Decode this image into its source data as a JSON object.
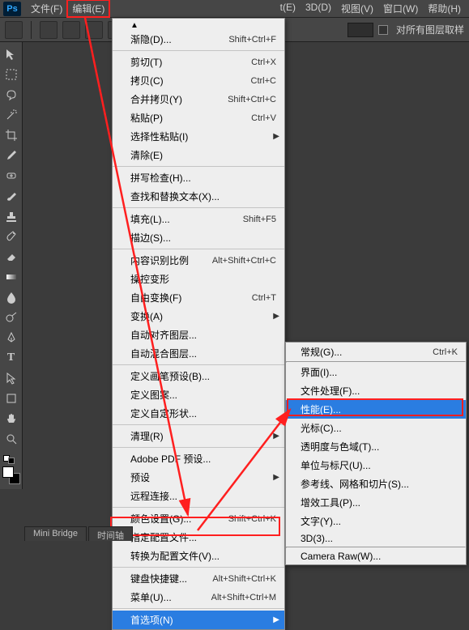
{
  "menubar": {
    "logo": "Ps",
    "items_left": [
      "文件(F)",
      "编辑(E)"
    ],
    "items_right": [
      "t(E)",
      "3D(D)",
      "视图(V)",
      "窗口(W)",
      "帮助(H)"
    ],
    "edit_index": 1
  },
  "toolbar": {
    "sample_all_layers": "对所有图层取样"
  },
  "edit_menu": {
    "items": [
      {
        "label": "渐隐(D)...",
        "shortcut": "Shift+Ctrl+F"
      },
      {
        "sep": true
      },
      {
        "label": "剪切(T)",
        "shortcut": "Ctrl+X"
      },
      {
        "label": "拷贝(C)",
        "shortcut": "Ctrl+C"
      },
      {
        "label": "合并拷贝(Y)",
        "shortcut": "Shift+Ctrl+C"
      },
      {
        "label": "粘贴(P)",
        "shortcut": "Ctrl+V"
      },
      {
        "label": "选择性粘贴(I)",
        "submenu": true
      },
      {
        "label": "清除(E)"
      },
      {
        "sep": true
      },
      {
        "label": "拼写检查(H)..."
      },
      {
        "label": "查找和替换文本(X)..."
      },
      {
        "sep": true
      },
      {
        "label": "填充(L)...",
        "shortcut": "Shift+F5"
      },
      {
        "label": "描边(S)..."
      },
      {
        "sep": true
      },
      {
        "label": "内容识别比例",
        "shortcut": "Alt+Shift+Ctrl+C"
      },
      {
        "label": "操控变形"
      },
      {
        "label": "自由变换(F)",
        "shortcut": "Ctrl+T"
      },
      {
        "label": "变换(A)",
        "submenu": true
      },
      {
        "label": "自动对齐图层..."
      },
      {
        "label": "自动混合图层..."
      },
      {
        "sep": true
      },
      {
        "label": "定义画笔预设(B)..."
      },
      {
        "label": "定义图案..."
      },
      {
        "label": "定义自定形状..."
      },
      {
        "sep": true
      },
      {
        "label": "清理(R)",
        "submenu": true
      },
      {
        "sep": true
      },
      {
        "label": "Adobe PDF 预设..."
      },
      {
        "label": "预设",
        "submenu": true
      },
      {
        "label": "远程连接..."
      },
      {
        "sep": true
      },
      {
        "label": "颜色设置(G)...",
        "shortcut": "Shift+Ctrl+K"
      },
      {
        "label": "指定配置文件..."
      },
      {
        "label": "转换为配置文件(V)..."
      },
      {
        "sep": true
      },
      {
        "label": "键盘快捷键...",
        "shortcut": "Alt+Shift+Ctrl+K"
      },
      {
        "label": "菜单(U)...",
        "shortcut": "Alt+Shift+Ctrl+M"
      },
      {
        "sep": true
      },
      {
        "label": "首选项(N)",
        "submenu": true,
        "highlight": true
      }
    ]
  },
  "prefs_submenu": {
    "items": [
      {
        "label": "常规(G)...",
        "shortcut": "Ctrl+K"
      },
      {
        "sep": true
      },
      {
        "label": "界面(I)..."
      },
      {
        "label": "文件处理(F)..."
      },
      {
        "label": "性能(E)...",
        "highlight": true
      },
      {
        "label": "光标(C)..."
      },
      {
        "label": "透明度与色域(T)..."
      },
      {
        "label": "单位与标尺(U)..."
      },
      {
        "label": "参考线、网格和切片(S)..."
      },
      {
        "label": "增效工具(P)..."
      },
      {
        "label": "文字(Y)..."
      },
      {
        "label": "3D(3)..."
      },
      {
        "sep": true
      },
      {
        "label": "Camera Raw(W)..."
      }
    ]
  },
  "bottom_tabs": [
    "Mini Bridge",
    "时间轴"
  ],
  "icons": {
    "triangle_up": "▲",
    "triangle_right": "▶"
  }
}
